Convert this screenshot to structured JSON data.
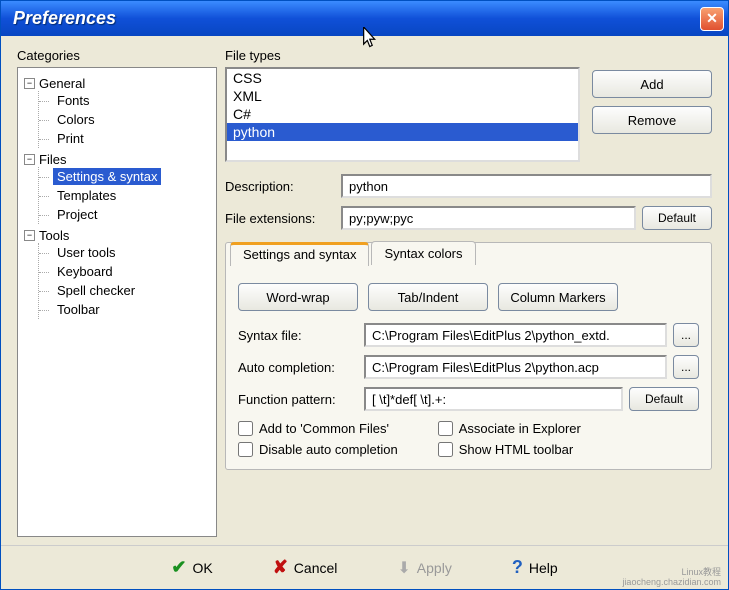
{
  "title": "Preferences",
  "categories_label": "Categories",
  "tree": {
    "general": {
      "label": "General",
      "children": [
        "Fonts",
        "Colors",
        "Print"
      ]
    },
    "files": {
      "label": "Files",
      "children": [
        "Settings & syntax",
        "Templates",
        "Project"
      ],
      "selected": "Settings & syntax"
    },
    "tools": {
      "label": "Tools",
      "children": [
        "User tools",
        "Keyboard",
        "Spell checker",
        "Toolbar"
      ]
    }
  },
  "filetypes": {
    "label": "File types",
    "items": [
      "CSS",
      "XML",
      "C#",
      "python"
    ],
    "selected": "python"
  },
  "buttons": {
    "add": "Add",
    "remove": "Remove",
    "default": "Default",
    "browse": "..."
  },
  "description": {
    "label": "Description:",
    "value": "python"
  },
  "extensions": {
    "label": "File extensions:",
    "value": "py;pyw;pyc"
  },
  "tabs": {
    "settings": "Settings and syntax",
    "colors": "Syntax colors"
  },
  "action_buttons": {
    "wrap": "Word-wrap",
    "tab": "Tab/Indent",
    "col": "Column Markers"
  },
  "syntax": {
    "label": "Syntax file:",
    "value": "C:\\Program Files\\EditPlus 2\\python_extd."
  },
  "autocomp": {
    "label": "Auto completion:",
    "value": "C:\\Program Files\\EditPlus 2\\python.acp"
  },
  "funcpat": {
    "label": "Function pattern:",
    "value": "[ \\t]*def[ \\t].+:"
  },
  "checks": {
    "common": "Add to 'Common Files'",
    "assoc": "Associate in Explorer",
    "disable_ac": "Disable auto completion",
    "html_tb": "Show HTML toolbar"
  },
  "bottom": {
    "ok": "OK",
    "cancel": "Cancel",
    "apply": "Apply",
    "help": "Help"
  },
  "watermark": {
    "line1": "Linux教程",
    "line2": "jiaocheng.chazidian.com"
  }
}
